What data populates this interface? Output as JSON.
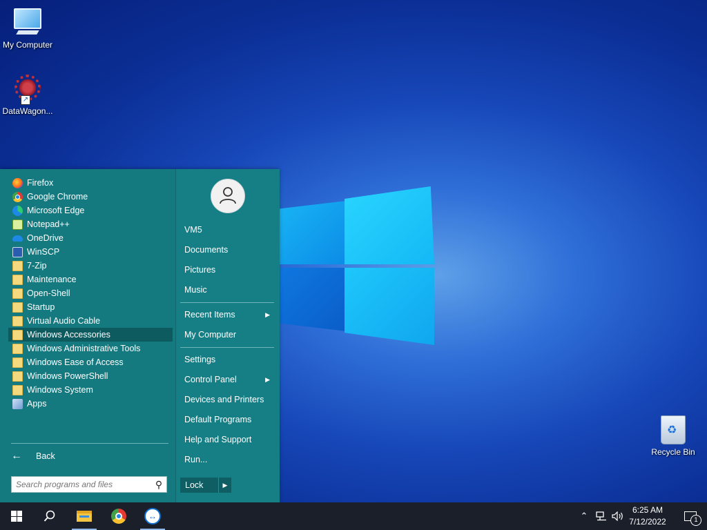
{
  "desktop": {
    "icons": [
      {
        "label": "My Computer",
        "icon": "computer-icon"
      },
      {
        "label": "DataWagon...",
        "icon": "datawagon-icon"
      },
      {
        "label": "Recycle Bin",
        "icon": "recycle-bin-icon"
      }
    ]
  },
  "start_menu": {
    "programs": [
      {
        "label": "Firefox",
        "icon": "firefox-icon"
      },
      {
        "label": "Google Chrome",
        "icon": "chrome-icon"
      },
      {
        "label": "Microsoft Edge",
        "icon": "edge-icon"
      },
      {
        "label": "Notepad++",
        "icon": "notepadpp-icon"
      },
      {
        "label": "OneDrive",
        "icon": "onedrive-icon"
      },
      {
        "label": "WinSCP",
        "icon": "winscp-icon"
      },
      {
        "label": "7-Zip",
        "icon": "folder-icon"
      },
      {
        "label": "Maintenance",
        "icon": "folder-icon"
      },
      {
        "label": "Open-Shell",
        "icon": "folder-icon"
      },
      {
        "label": "Startup",
        "icon": "folder-icon"
      },
      {
        "label": "Virtual Audio Cable",
        "icon": "folder-icon"
      },
      {
        "label": "Windows Accessories",
        "icon": "folder-icon",
        "selected": true
      },
      {
        "label": "Windows Administrative Tools",
        "icon": "folder-icon"
      },
      {
        "label": "Windows Ease of Access",
        "icon": "folder-icon"
      },
      {
        "label": "Windows PowerShell",
        "icon": "folder-icon"
      },
      {
        "label": "Windows System",
        "icon": "folder-icon"
      },
      {
        "label": "Apps",
        "icon": "apps-icon"
      }
    ],
    "back_label": "Back",
    "search_placeholder": "Search programs and files",
    "right": {
      "user": "VM5",
      "documents": "Documents",
      "pictures": "Pictures",
      "music": "Music",
      "recent_items": "Recent Items",
      "my_computer": "My Computer",
      "settings": "Settings",
      "control_panel": "Control Panel",
      "devices_printers": "Devices and Printers",
      "default_programs": "Default Programs",
      "help_support": "Help and Support",
      "run": "Run...",
      "lock": "Lock"
    }
  },
  "taskbar": {
    "time": "6:25 AM",
    "date": "7/12/2022",
    "notification_count": "1"
  },
  "colors": {
    "start_menu_bg": "#187b82",
    "selected_item": "#0d5a5f",
    "taskbar_bg": "#1a1f2a"
  }
}
